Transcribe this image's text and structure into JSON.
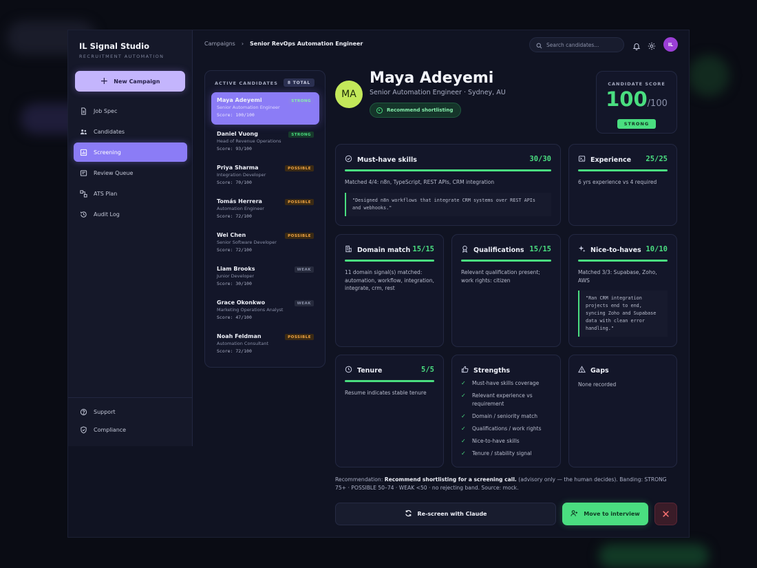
{
  "app": {
    "brand": "IL Signal Studio",
    "brand_sub": "RECRUITMENT AUTOMATION",
    "new_campaign": "New Campaign"
  },
  "nav": {
    "items": [
      {
        "label": "Job Spec",
        "icon": "document-icon"
      },
      {
        "label": "Candidates",
        "icon": "users-icon"
      },
      {
        "label": "Screening",
        "icon": "chart-icon",
        "active": true
      },
      {
        "label": "Review Queue",
        "icon": "queue-icon"
      },
      {
        "label": "ATS Plan",
        "icon": "plan-icon"
      },
      {
        "label": "Audit Log",
        "icon": "history-icon"
      }
    ],
    "bottom": [
      {
        "label": "Support",
        "icon": "help-icon"
      },
      {
        "label": "Compliance",
        "icon": "shield-icon"
      }
    ]
  },
  "topbar": {
    "crumb_root": "Campaigns",
    "crumb_current": "Senior RevOps Automation Engineer",
    "search_placeholder": "Search candidates...",
    "avatar": "IL"
  },
  "candidates": {
    "heading": "ACTIVE CANDIDATES",
    "total": "8 TOTAL",
    "items": [
      {
        "name": "Maya Adeyemi",
        "role": "Senior Automation Engineer",
        "score": "Score: 100/100",
        "band": "STRONG",
        "level": "strong",
        "active": true
      },
      {
        "name": "Daniel Vuong",
        "role": "Head of Revenue Operations",
        "score": "Score: 93/100",
        "band": "STRONG",
        "level": "strong"
      },
      {
        "name": "Priya Sharma",
        "role": "Integration Developer",
        "score": "Score: 70/100",
        "band": "POSSIBLE",
        "level": "possible"
      },
      {
        "name": "Tomás Herrera",
        "role": "Automation Engineer",
        "score": "Score: 72/100",
        "band": "POSSIBLE",
        "level": "possible"
      },
      {
        "name": "Wei Chen",
        "role": "Senior Software Developer",
        "score": "Score: 72/100",
        "band": "POSSIBLE",
        "level": "possible"
      },
      {
        "name": "Liam Brooks",
        "role": "Junior Developer",
        "score": "Score: 30/100",
        "band": "WEAK",
        "level": "weak"
      },
      {
        "name": "Grace Okonkwo",
        "role": "Marketing Operations Analyst",
        "score": "Score: 47/100",
        "band": "WEAK",
        "level": "weak"
      },
      {
        "name": "Noah Feldman",
        "role": "Automation Consultant",
        "score": "Score: 72/100",
        "band": "POSSIBLE",
        "level": "possible"
      }
    ]
  },
  "profile": {
    "initials": "MA",
    "name": "Maya Adeyemi",
    "role": "Senior Automation Engineer · Sydney, AU",
    "recommendation_chip": "Recommend shortlisting"
  },
  "score": {
    "label": "CANDIDATE SCORE",
    "value": "100",
    "max": "/100",
    "band": "STRONG"
  },
  "cards": {
    "must": {
      "title": "Must-have skills",
      "score": "30/30",
      "fill": 1.0,
      "text": "Matched 4/4: n8n, TypeScript, REST APIs, CRM integration",
      "quote": "\"Designed n8n workflows that integrate CRM systems over REST APIs and webhooks.\""
    },
    "experience": {
      "title": "Experience",
      "score": "25/25",
      "fill": 1.0,
      "text": "6 yrs experience vs 4 required"
    },
    "domain": {
      "title": "Domain match",
      "score": "15/15",
      "fill": 1.0,
      "text": "11 domain signal(s) matched: automation, workflow, integration, integrate, crm, rest"
    },
    "qual": {
      "title": "Qualifications",
      "score": "15/15",
      "fill": 1.0,
      "text": "Relevant qualification present; work rights: citizen"
    },
    "nice": {
      "title": "Nice-to-haves",
      "score": "10/10",
      "fill": 1.0,
      "text": "Matched 3/3: Supabase, Zoho, AWS",
      "quote": "\"Ran CRM integration projects end to end, syncing Zoho and Supabase data with clean error handling.\""
    },
    "tenure": {
      "title": "Tenure",
      "score": "5/5",
      "fill": 1.0,
      "text": "Resume indicates stable tenure"
    },
    "strengths": {
      "title": "Strengths",
      "items": [
        "Must-have skills coverage",
        "Relevant experience vs requirement",
        "Domain / seniority match",
        "Qualifications / work rights",
        "Nice-to-have skills",
        "Tenure / stability signal"
      ]
    },
    "gaps": {
      "title": "Gaps",
      "text": "None recorded"
    }
  },
  "recommendation": {
    "prefix": "Recommendation:",
    "bold": "Recommend shortlisting for a screening call.",
    "rest": "(advisory only — the human decides). Banding: STRONG 75+ · POSSIBLE 50–74 · WEAK <50 · no rejecting band. Source: mock."
  },
  "actions": {
    "rescreen": "Re-screen with Claude",
    "move": "Move to interview",
    "reject_icon": "close-icon"
  },
  "colors": {
    "accent": "#8b7cf6",
    "success": "#4ade80",
    "warning": "#f5a742",
    "danger": "#f87171",
    "background": "#101322"
  }
}
